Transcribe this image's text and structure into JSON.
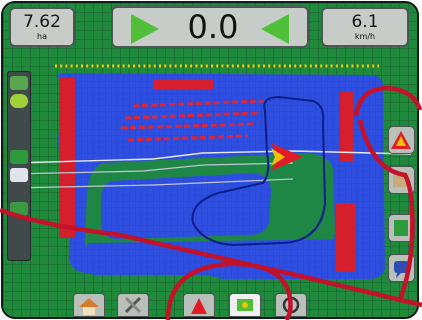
{
  "topbar": {
    "area": {
      "value": "7.62",
      "unit": "ha"
    },
    "cross_track": {
      "value": "0.0"
    },
    "speed": {
      "value": "6.1",
      "unit": "km/h"
    }
  },
  "colors": {
    "background_green": "#1f8a3c",
    "coverage_blue": "#2f4fe0",
    "boundary_red": "#d61f2c",
    "annotation_red": "#c4122a",
    "guidance_arrow": "#4fbf3a",
    "vehicle_red": "#e01c24",
    "vehicle_yellow": "#f2c200",
    "panel_grey": "#b9bfb9"
  },
  "icons": {
    "left_panel": [
      "gps-status-icon",
      "zoom-extents-icon",
      "view-perspective-icon",
      "marker-icon",
      "boundary-icon"
    ],
    "right_panel": [
      "guidance-mode-icon",
      "swath-icon",
      "boundary-settings-icon",
      "chat-icon"
    ],
    "bottom_bar": [
      "home-icon",
      "tools-icon",
      "guidance-icon",
      "marker-point-icon",
      "steering-icon"
    ]
  }
}
